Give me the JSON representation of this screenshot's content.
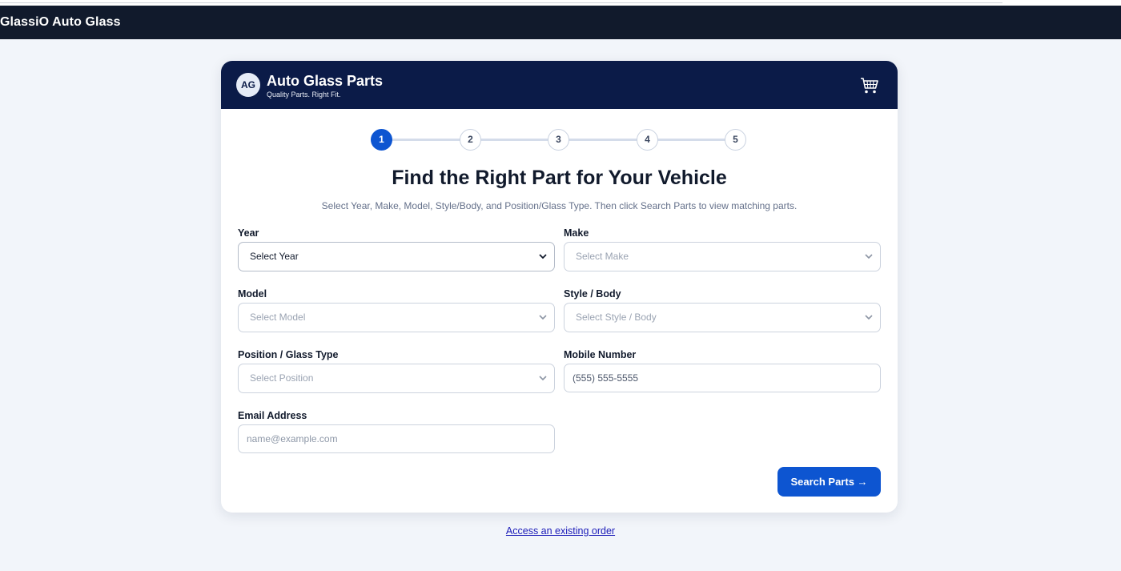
{
  "navbar": {
    "brand": "GlassiO Auto Glass"
  },
  "card_header": {
    "logo_text": "AG",
    "title": "Auto Glass Parts",
    "subtitle": "Quality Parts. Right Fit.",
    "cart_icon": "cart-icon"
  },
  "stepper": {
    "steps": [
      "1",
      "2",
      "3",
      "4",
      "5"
    ],
    "active_step": 1
  },
  "heading": "Find the Right Part for Your Vehicle",
  "intro": "Select Year, Make, Model, Style/Body, and Position/Glass Type. Then click Search Parts to view matching parts.",
  "form": {
    "year": {
      "label": "Year",
      "value": "Select Year"
    },
    "make": {
      "label": "Make",
      "value": "Select Make"
    },
    "model": {
      "label": "Model",
      "value": "Select Model"
    },
    "style": {
      "label": "Style / Body",
      "value": "Select Style / Body"
    },
    "position": {
      "label": "Position / Glass Type",
      "value": "Select Position"
    },
    "mobile": {
      "label": "Mobile Number",
      "placeholder": "(555) 555-5555"
    },
    "email": {
      "label": "Email Address",
      "placeholder": "name@example.com"
    }
  },
  "search_button": "Search Parts →",
  "existing_order_link": "Access an existing order",
  "colors": {
    "navbar_bg": "#111a2c",
    "card_header_bg": "#0b1b48",
    "accent": "#0d55d1",
    "page_bg": "#f2f5fa"
  }
}
